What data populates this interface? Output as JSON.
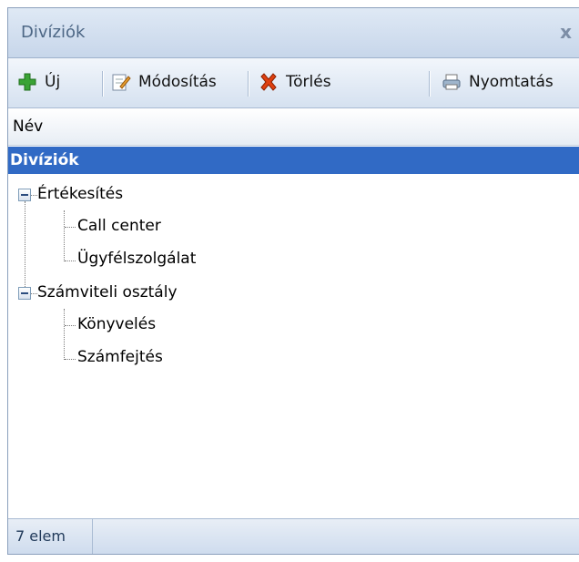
{
  "window": {
    "title": "Divíziók",
    "close_glyph": "x"
  },
  "toolbar": {
    "new_label": "Új",
    "edit_label": "Módosítás",
    "delete_label": "Törlés",
    "print_label": "Nyomtatás",
    "icons": {
      "new": "plus-icon",
      "edit": "edit-note-icon",
      "delete": "delete-x-icon",
      "print": "printer-icon"
    }
  },
  "grid": {
    "column_header": "Név"
  },
  "tree": {
    "root": "Divíziók",
    "groups": [
      {
        "label": "Értékesítés",
        "children": [
          "Call center",
          "Ügyfélszolgálat"
        ]
      },
      {
        "label": "Számviteli osztály",
        "children": [
          "Könyvelés",
          "Számfejtés"
        ]
      }
    ]
  },
  "status": {
    "count_text": "7 elem"
  },
  "colors": {
    "selection": "#316ac5",
    "accent_green": "#3aa335",
    "accent_red": "#e04010"
  }
}
